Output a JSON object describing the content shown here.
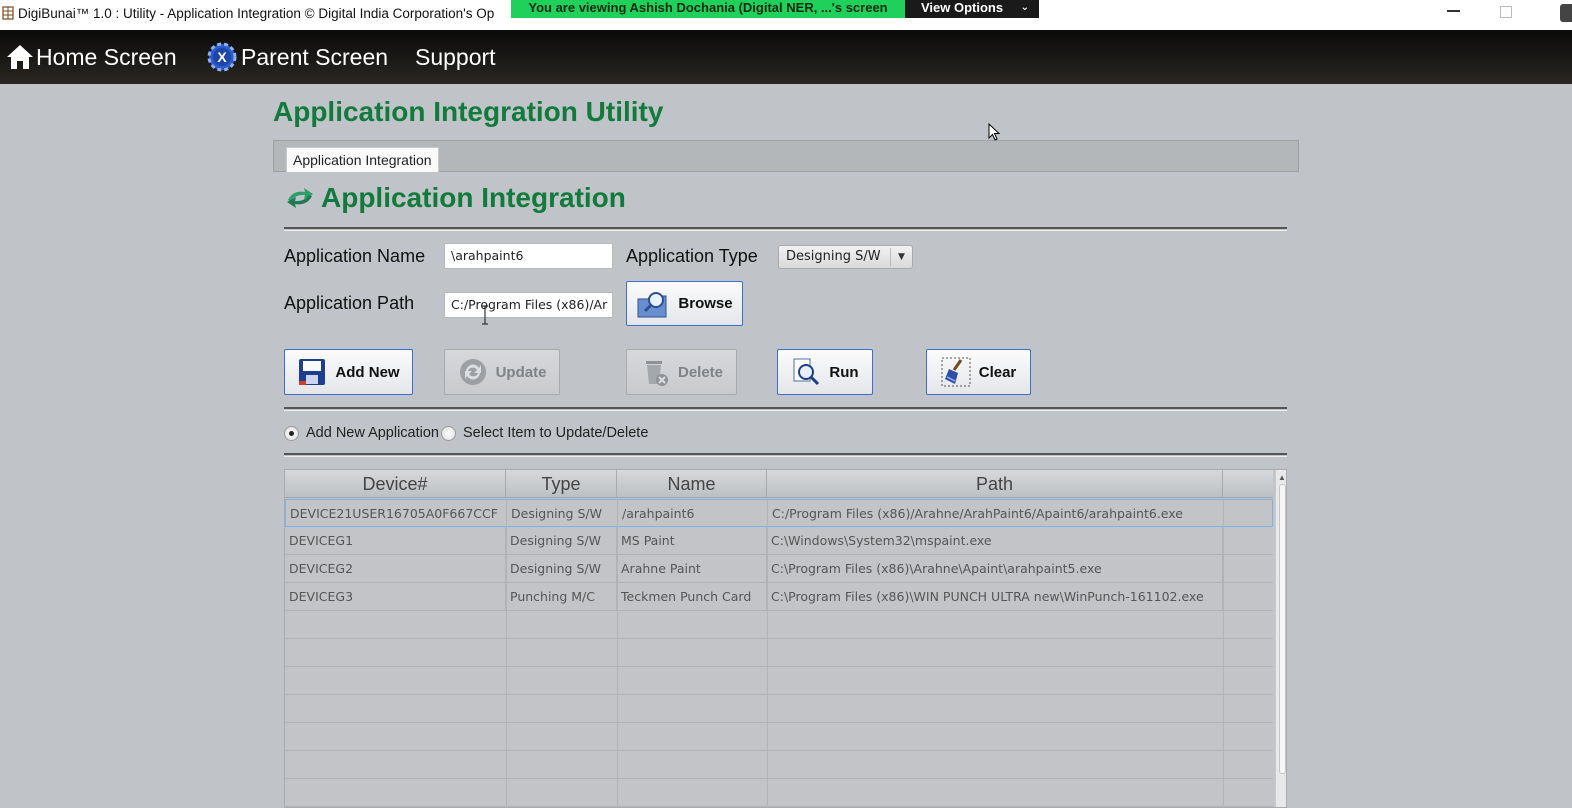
{
  "window": {
    "title": "DigiBunai™ 1.0 : Utility - Application Integration © Digital India Corporation's Op",
    "share_banner": "You are viewing Ashish Dochania (Digital NER, ...'s screen",
    "view_options": "View Options"
  },
  "menu": {
    "home": "Home Screen",
    "parent": "Parent Screen",
    "support": "Support"
  },
  "page": {
    "title": "Application Integration Utility",
    "tab": "Application Integration",
    "section_title": "Application Integration"
  },
  "form": {
    "app_name_label": "Application Name",
    "app_name_value": "\\arahpaint6",
    "app_type_label": "Application Type",
    "app_type_value": "Designing S/W",
    "app_path_label": "Application Path",
    "app_path_value": "C:/Program Files (x86)/Ar",
    "browse_label": "Browse"
  },
  "actions": {
    "add_new": "Add New",
    "update": "Update",
    "delete": "Delete",
    "run": "Run",
    "clear": "Clear"
  },
  "mode": {
    "add_new_option": "Add New Application",
    "select_option": "Select Item to  Update/Delete",
    "selected": "add_new"
  },
  "table": {
    "columns": [
      "Device#",
      "Type",
      "Name",
      "Path"
    ],
    "rows": [
      [
        "DEVICE21USER16705A0F667CCF",
        "Designing S/W",
        "/arahpaint6",
        "C:/Program Files (x86)/Arahne/ArahPaint6/Apaint6/arahpaint6.exe"
      ],
      [
        "DEVICEG1",
        "Designing S/W",
        "MS Paint",
        "C:\\Windows\\System32\\mspaint.exe"
      ],
      [
        "DEVICEG2",
        "Designing S/W",
        "Arahne Paint",
        "C:\\Program Files (x86)\\Arahne\\Apaint\\arahpaint5.exe"
      ],
      [
        "DEVICEG3",
        "Punching M/C",
        "Teckmen Punch Card",
        "C:\\Program Files (x86)\\WIN PUNCH ULTRA new\\WinPunch-161102.exe"
      ]
    ]
  },
  "colors": {
    "brand_green": "#117a3c",
    "banner_green": "#1fd05a",
    "button_border": "#3b6fd0"
  }
}
